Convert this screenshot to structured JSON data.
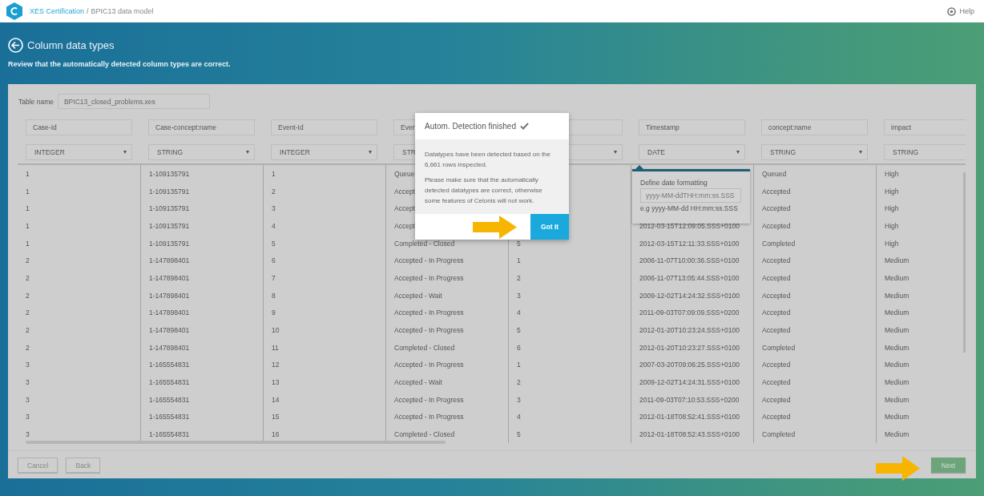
{
  "top_bar": {
    "breadcrumb_link": "XES Certification",
    "breadcrumb_separator": "/",
    "breadcrumb_current": "BPIC13 data model",
    "help": "Help"
  },
  "page": {
    "title": "Column data types",
    "subtitle": "Review that the automatically detected column types are correct."
  },
  "table_name": {
    "label": "Table name",
    "value": "BPIC13_closed_problems.xes"
  },
  "columns": [
    {
      "name": "Case-Id",
      "type": "INTEGER"
    },
    {
      "name": "Case-concept:name",
      "type": "STRING"
    },
    {
      "name": "Event-Id",
      "type": "INTEGER"
    },
    {
      "name": "Even",
      "type": "STR"
    },
    {},
    {
      "name": "Timestamp",
      "type": "DATE"
    },
    {
      "name": "concept:name",
      "type": "STRING"
    },
    {
      "name": "impact",
      "type": "STRING"
    }
  ],
  "rows": [
    [
      "1",
      "1-109135791",
      "1",
      "Queue",
      null,
      null,
      "Queued",
      "High"
    ],
    [
      "1",
      "1-109135791",
      "2",
      "Accept",
      null,
      null,
      "Accepted",
      "High"
    ],
    [
      "1",
      "1-109135791",
      "3",
      "Accept",
      null,
      null,
      "Accepted",
      "High"
    ],
    [
      "1",
      "1-109135791",
      "4",
      "Accept",
      null,
      "2012-03-15T12:09:05.SSS+0100",
      "Accepted",
      "High"
    ],
    [
      "1",
      "1-109135791",
      "5",
      "Completed - Closed",
      "5",
      "2012-03-15T12:11:33.SSS+0100",
      "Completed",
      "High"
    ],
    [
      "2",
      "1-147898401",
      "6",
      "Accepted - In Progress",
      "1",
      "2006-11-07T10:00:36.SSS+0100",
      "Accepted",
      "Medium"
    ],
    [
      "2",
      "1-147898401",
      "7",
      "Accepted - In Progress",
      "2",
      "2006-11-07T13:05:44.SSS+0100",
      "Accepted",
      "Medium"
    ],
    [
      "2",
      "1-147898401",
      "8",
      "Accepted - Wait",
      "3",
      "2009-12-02T14:24:32.SSS+0100",
      "Accepted",
      "Medium"
    ],
    [
      "2",
      "1-147898401",
      "9",
      "Accepted - In Progress",
      "4",
      "2011-09-03T07:09:09.SSS+0200",
      "Accepted",
      "Medium"
    ],
    [
      "2",
      "1-147898401",
      "10",
      "Accepted - In Progress",
      "5",
      "2012-01-20T10:23:24.SSS+0100",
      "Accepted",
      "Medium"
    ],
    [
      "2",
      "1-147898401",
      "11",
      "Completed - Closed",
      "6",
      "2012-01-20T10:23:27.SSS+0100",
      "Completed",
      "Medium"
    ],
    [
      "3",
      "1-165554831",
      "12",
      "Accepted - In Progress",
      "1",
      "2007-03-20T09:06:25.SSS+0100",
      "Accepted",
      "Medium"
    ],
    [
      "3",
      "1-165554831",
      "13",
      "Accepted - Wait",
      "2",
      "2009-12-02T14:24:31.SSS+0100",
      "Accepted",
      "Medium"
    ],
    [
      "3",
      "1-165554831",
      "14",
      "Accepted - In Progress",
      "3",
      "2011-09-03T07:10:53.SSS+0200",
      "Accepted",
      "Medium"
    ],
    [
      "3",
      "1-165554831",
      "15",
      "Accepted - In Progress",
      "4",
      "2012-01-18T08:52:41.SSS+0100",
      "Accepted",
      "Medium"
    ],
    [
      "3",
      "1-165554831",
      "16",
      "Completed - Closed",
      "5",
      "2012-01-18T08:52:43.SSS+0100",
      "Completed",
      "Medium"
    ]
  ],
  "date_format_popover": {
    "label": "Define date formatting",
    "placeholder": "yyyy-MM-ddTHH:mm:ss.SSS",
    "example": "e.g yyyy-MM-dd HH:mm:ss.SSS"
  },
  "detection_dialog": {
    "title": "Autom. Detection finished",
    "paragraphs": [
      "Datatypes have been detected based on the 6,661 rows inspected.",
      "Please make sure that the automatically detected datatypes are correct, otherwise some features of Celonis will not work."
    ],
    "button": "Got It"
  },
  "footer": {
    "buttons": [
      "Cancel",
      "Back"
    ],
    "next": "Next"
  }
}
